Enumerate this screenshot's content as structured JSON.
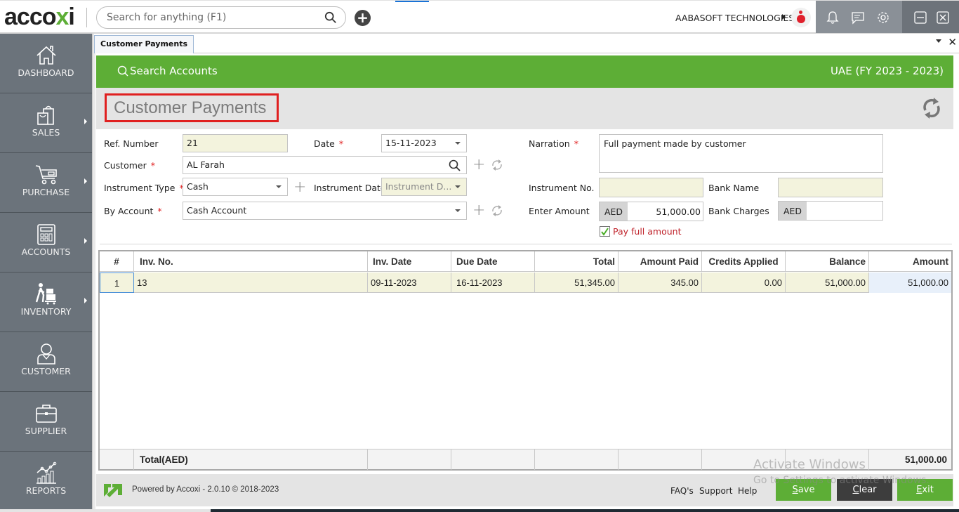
{
  "app": {
    "logo_text": "acco",
    "logo_accent": "x",
    "logo_tail": "i",
    "search_placeholder": "Search for anything (F1)",
    "company_name": "AABASOFT TECHNOLOGIES",
    "icons": {
      "add": "plus-circle-icon",
      "notifications": "bell-icon",
      "messages": "message-icon",
      "settings": "gear-icon",
      "minimize": "minimize-icon",
      "close": "close-icon"
    }
  },
  "sidebar": {
    "items": [
      {
        "label": "DASHBOARD",
        "icon": "home-icon",
        "has_submenu": false
      },
      {
        "label": "SALES",
        "icon": "shopping-bag-icon",
        "has_submenu": true
      },
      {
        "label": "PURCHASE",
        "icon": "cart-icon",
        "has_submenu": true
      },
      {
        "label": "ACCOUNTS",
        "icon": "calculator-icon",
        "has_submenu": true
      },
      {
        "label": "INVENTORY",
        "icon": "trolley-icon",
        "has_submenu": true
      },
      {
        "label": "CUSTOMER",
        "icon": "person-icon",
        "has_submenu": false
      },
      {
        "label": "SUPPLIER",
        "icon": "briefcase-icon",
        "has_submenu": false
      },
      {
        "label": "REPORTS",
        "icon": "chart-icon",
        "has_submenu": false
      }
    ]
  },
  "tabs": [
    {
      "label": "Customer Payments",
      "active": true
    }
  ],
  "header": {
    "search_accounts": "Search Accounts",
    "fiscal_year": "UAE (FY 2023 - 2023)",
    "page_title": "Customer Payments"
  },
  "form": {
    "ref_number": {
      "label": "Ref. Number",
      "value": "21"
    },
    "date": {
      "label": "Date",
      "value": "15-11-2023",
      "required": true
    },
    "customer": {
      "label": "Customer",
      "value": "AL Farah",
      "required": true
    },
    "instrument_type": {
      "label": "Instrument Type",
      "value": "Cash",
      "required": true
    },
    "instrument_date": {
      "label": "Instrument Date",
      "placeholder": "Instrument D..."
    },
    "by_account": {
      "label": "By Account",
      "value": "Cash Account",
      "required": true
    },
    "narration": {
      "label": "Narration",
      "value": "Full payment made by customer",
      "required": true
    },
    "instrument_no": {
      "label": "Instrument No.",
      "value": ""
    },
    "bank_name": {
      "label": "Bank Name",
      "value": ""
    },
    "enter_amount": {
      "label": "Enter Amount",
      "currency": "AED",
      "value": "51,000.00"
    },
    "bank_charges": {
      "label": "Bank Charges",
      "currency": "AED",
      "value": ""
    },
    "pay_full_amount": {
      "label": "Pay full amount",
      "checked": true
    },
    "required_mark": "*"
  },
  "grid": {
    "columns": [
      "#",
      "Inv. No.",
      "Inv. Date",
      "Due Date",
      "Total",
      "Amount Paid",
      "Credits Applied",
      "Balance",
      "Amount"
    ],
    "rows": [
      {
        "num": "1",
        "inv_no": "13",
        "inv_date": "09-11-2023",
        "due_date": "16-11-2023",
        "total": "51,345.00",
        "amount_paid": "345.00",
        "credits_applied": "0.00",
        "balance": "51,000.00",
        "amount": "51,000.00"
      }
    ],
    "total_label": "Total(AED)",
    "total_amount": "51,000.00"
  },
  "footer": {
    "powered_by": "Powered by Accoxi - 2.0.10 © 2018-2023",
    "links": [
      "FAQ's",
      "Support",
      "Help"
    ],
    "buttons": {
      "save": {
        "first": "S",
        "rest": "ave"
      },
      "clear": {
        "first": "C",
        "rest": "lear"
      },
      "exit": {
        "first": "E",
        "rest": "xit"
      }
    },
    "colors": {
      "save": "#5dae36",
      "clear": "#3d3d3d",
      "exit": "#5dae36"
    }
  },
  "watermark": {
    "line1": "Activate Windows",
    "line2": "Go to Settings to activate Windows."
  }
}
